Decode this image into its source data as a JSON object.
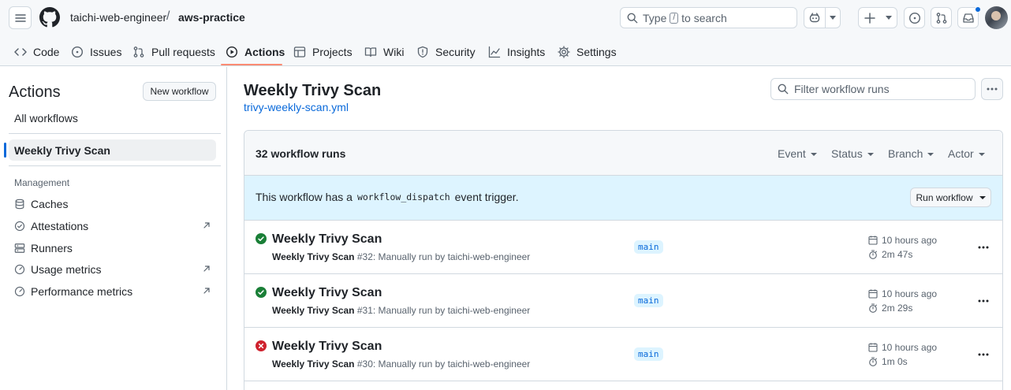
{
  "header": {
    "owner": "taichi-web-engineer",
    "separator": "/",
    "repo": "aws-practice",
    "search_prefix": "Type",
    "search_key": "/",
    "search_suffix": "to search"
  },
  "repo_nav": {
    "tabs": [
      {
        "label": "Code",
        "icon": "code-icon"
      },
      {
        "label": "Issues",
        "icon": "issue-icon"
      },
      {
        "label": "Pull requests",
        "icon": "pull-request-icon"
      },
      {
        "label": "Actions",
        "icon": "play-icon",
        "active": true
      },
      {
        "label": "Projects",
        "icon": "table-icon"
      },
      {
        "label": "Wiki",
        "icon": "book-icon"
      },
      {
        "label": "Security",
        "icon": "shield-icon"
      },
      {
        "label": "Insights",
        "icon": "graph-icon"
      },
      {
        "label": "Settings",
        "icon": "gear-icon"
      }
    ]
  },
  "sidebar": {
    "title": "Actions",
    "new_workflow": "New workflow",
    "all_workflows": "All workflows",
    "active_workflow": "Weekly Trivy Scan",
    "section": "Management",
    "items": [
      {
        "label": "Caches",
        "icon": "database-icon",
        "external": false
      },
      {
        "label": "Attestations",
        "icon": "verified-icon",
        "external": true
      },
      {
        "label": "Runners",
        "icon": "server-icon",
        "external": false
      },
      {
        "label": "Usage metrics",
        "icon": "meter-icon",
        "external": true
      },
      {
        "label": "Performance metrics",
        "icon": "meter-icon",
        "external": true
      }
    ]
  },
  "main": {
    "title": "Weekly Trivy Scan",
    "file": "trivy-weekly-scan.yml",
    "filter_placeholder": "Filter workflow runs",
    "run_count": "32 workflow runs",
    "filters": [
      "Event",
      "Status",
      "Branch",
      "Actor"
    ],
    "dispatch_before": "This workflow has a",
    "dispatch_code": "workflow_dispatch",
    "dispatch_after": "event trigger.",
    "run_workflow": "Run workflow",
    "runs": [
      {
        "name": "Weekly Trivy Scan",
        "workflow": "Weekly Trivy Scan",
        "detail": " #32: Manually run by taichi-web-engineer",
        "branch": "main",
        "when": "10 hours ago",
        "duration": "2m 47s",
        "status": "success"
      },
      {
        "name": "Weekly Trivy Scan",
        "workflow": "Weekly Trivy Scan",
        "detail": " #31: Manually run by taichi-web-engineer",
        "branch": "main",
        "when": "10 hours ago",
        "duration": "2m 29s",
        "status": "success"
      },
      {
        "name": "Weekly Trivy Scan",
        "workflow": "Weekly Trivy Scan",
        "detail": " #30: Manually run by taichi-web-engineer",
        "branch": "main",
        "when": "10 hours ago",
        "duration": "1m 0s",
        "status": "failure"
      }
    ]
  },
  "colors": {
    "success": "#1a7f37",
    "failure": "#cf222e",
    "accent": "#0969da",
    "active_underline": "#fd8c73"
  }
}
